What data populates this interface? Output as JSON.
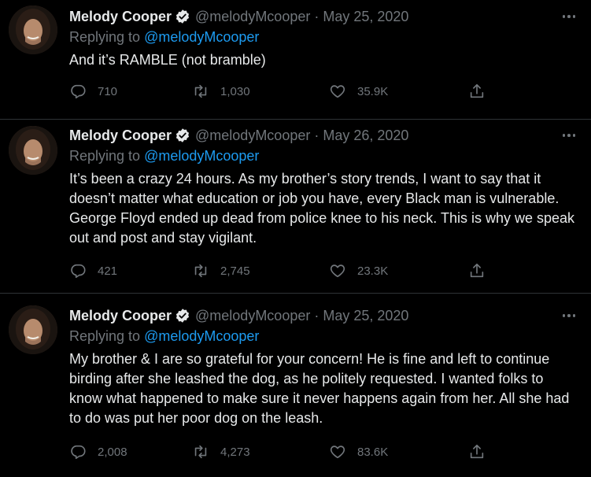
{
  "tweets": [
    {
      "display_name": "Melody Cooper",
      "handle": "@melodyMcooper",
      "separator": "·",
      "date": "May 25, 2020",
      "replying_prefix": "Replying to",
      "replying_to": "@melodyMcooper",
      "text": "And it’s RAMBLE (not bramble)",
      "replies": "710",
      "retweets": "1,030",
      "likes": "35.9K"
    },
    {
      "display_name": "Melody Cooper",
      "handle": "@melodyMcooper",
      "separator": "·",
      "date": "May 26, 2020",
      "replying_prefix": "Replying to",
      "replying_to": "@melodyMcooper",
      "text": "It’s been a crazy 24 hours. As my brother’s story trends, I want to say that it doesn’t matter what education or job you have,  every Black man is vulnerable. George Floyd ended up dead from police knee to his neck. This is why we speak out and post and stay vigilant.",
      "replies": "421",
      "retweets": "2,745",
      "likes": "23.3K"
    },
    {
      "display_name": "Melody Cooper",
      "handle": "@melodyMcooper",
      "separator": "·",
      "date": "May 25, 2020",
      "replying_prefix": "Replying to",
      "replying_to": "@melodyMcooper",
      "text": "My brother & I are so grateful for your concern! He is fine and left to continue birding after she leashed the dog, as he politely requested.  I wanted folks to know what happened to make sure it never happens again from her.  All she had to do was put her poor dog on the leash.",
      "replies": "2,008",
      "retweets": "4,273",
      "likes": "83.6K"
    }
  ],
  "icons": {
    "verified": "verified-badge-icon",
    "more": "more-dots-icon",
    "reply": "reply-bubble-icon",
    "retweet": "retweet-arrows-icon",
    "like": "heart-icon",
    "share": "share-upload-icon"
  },
  "colors": {
    "background": "#000000",
    "text": "#e7e9ea",
    "muted": "#71767b",
    "link": "#1d9bf0",
    "divider": "#2f3336"
  }
}
